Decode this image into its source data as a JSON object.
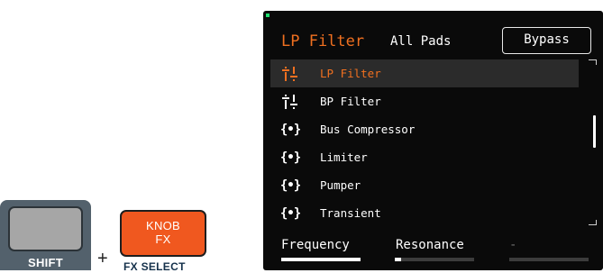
{
  "hardware": {
    "shift_label": "SHIFT",
    "plus": "+",
    "knob_line1": "KNOB",
    "knob_line2": "FX",
    "fx_select_label": "FX SELECT"
  },
  "screen": {
    "title": "LP Filter",
    "scope": "All Pads",
    "bypass_label": "Bypass",
    "fx_list": [
      {
        "label": "LP Filter",
        "icon": "filter-icon",
        "selected": true
      },
      {
        "label": "BP Filter",
        "icon": "filter-icon",
        "selected": false
      },
      {
        "label": "Bus Compressor",
        "icon": "dynamics-icon",
        "selected": false
      },
      {
        "label": "Limiter",
        "icon": "dynamics-icon",
        "selected": false
      },
      {
        "label": "Pumper",
        "icon": "dynamics-icon",
        "selected": false
      },
      {
        "label": "Transient",
        "icon": "dynamics-icon",
        "selected": false
      }
    ],
    "params": [
      {
        "label": "Frequency",
        "level": 1.0
      },
      {
        "label": "Resonance",
        "level": 0.08
      },
      {
        "label": "-",
        "level": 0.0
      }
    ]
  },
  "colors": {
    "accent": "#f07020",
    "shift_button": "#53616c",
    "knob_button": "#f0581f",
    "screen_bg": "#0a0a0a",
    "selected_row": "#2b2b2b",
    "status_led": "#20e070"
  }
}
